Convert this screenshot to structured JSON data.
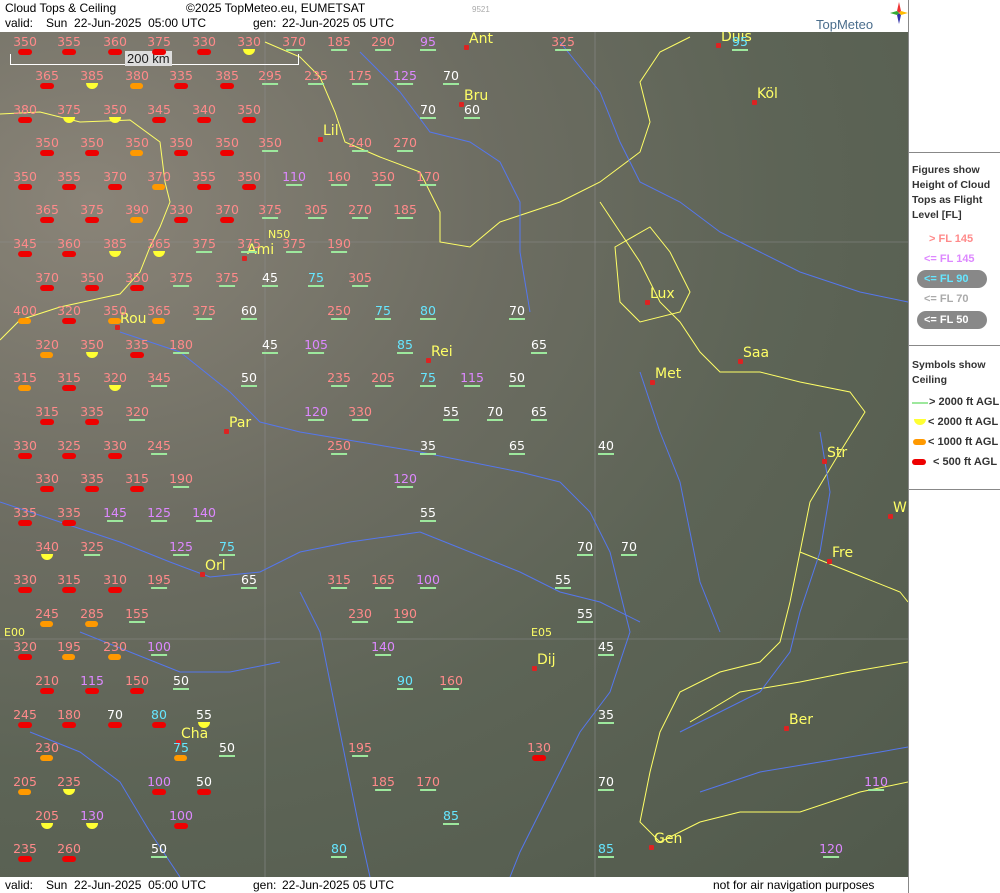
{
  "header": {
    "app_title": "Cloud Tops & Ceiling",
    "copyright": "©2025 TopMeteo.eu, EUMETSAT",
    "valid_label": "valid:",
    "valid_time": "Sun  22-Jun-2025  05:00 UTC",
    "gen_label": "gen:",
    "gen_time": "22-Jun-2025 05 UTC",
    "watermark": "9521",
    "brand": "TopMeteo"
  },
  "footer": {
    "valid_label": "valid:",
    "valid_time": "Sun  22-Jun-2025  05:00 UTC",
    "gen_label": "gen:",
    "gen_time": "22-Jun-2025 05 UTC",
    "disclaimer": "not for air navigation purposes"
  },
  "scale": {
    "label": "200 km"
  },
  "coords": {
    "n50": "N50",
    "e00": "E00",
    "e05": "E05"
  },
  "cities": [
    {
      "name": "Ant"
    },
    {
      "name": "Duis"
    },
    {
      "name": "Bru"
    },
    {
      "name": "Köl"
    },
    {
      "name": "Lil"
    },
    {
      "name": "Ami"
    },
    {
      "name": "Lux"
    },
    {
      "name": "Rou"
    },
    {
      "name": "Rei"
    },
    {
      "name": "Saa"
    },
    {
      "name": "Met"
    },
    {
      "name": "Par"
    },
    {
      "name": "Str"
    },
    {
      "name": "W"
    },
    {
      "name": "Fre"
    },
    {
      "name": "Orl"
    },
    {
      "name": "Dij"
    },
    {
      "name": "Ber"
    },
    {
      "name": "Cha"
    },
    {
      "name": "Gen"
    }
  ],
  "legend": {
    "figures_title": [
      "Figures show",
      "Height of Cloud",
      "Tops as Flight",
      "Level  [FL]"
    ],
    "fl_items": [
      "> FL 145",
      "<= FL 145",
      "<= FL 90",
      "<= FL 70",
      "<= FL 50"
    ],
    "symbols_title": [
      "Symbols show",
      "Ceiling"
    ],
    "sym_items": [
      "> 2000 ft AGL",
      "< 2000 ft AGL",
      "< 1000 ft AGL",
      "< 500 ft AGL"
    ],
    "colors": {
      "hi": "#ff8a8a",
      "mid": "#dd88ff",
      "low": "#66e6ff",
      "vl": "#ffffff",
      "line": "#9de89d",
      "yel": "#ffff33",
      "org": "#ff9900",
      "red": "#ee0000"
    }
  },
  "observations": [
    [
      "350",
      "hi",
      "red"
    ],
    [
      "355",
      "hi",
      "red"
    ],
    [
      "360",
      "hi",
      "red"
    ],
    [
      "375",
      "hi",
      "red"
    ],
    [
      "330",
      "hi",
      "red"
    ],
    [
      "330",
      "hi",
      "yel"
    ],
    [
      "370",
      "hi",
      "line"
    ],
    [
      "185",
      "hi",
      "line"
    ],
    [
      "290",
      "hi",
      "line"
    ],
    [
      "95",
      "mid",
      "line"
    ],
    [
      "325",
      "hi",
      "line"
    ],
    [
      "95",
      "low",
      "line"
    ],
    [
      "365",
      "hi",
      "red"
    ],
    [
      "385",
      "hi",
      "yel"
    ],
    [
      "380",
      "hi",
      "org"
    ],
    [
      "335",
      "hi",
      "red"
    ],
    [
      "385",
      "hi",
      "red"
    ],
    [
      "295",
      "hi",
      "line"
    ],
    [
      "235",
      "hi",
      "line"
    ],
    [
      "175",
      "hi",
      "line"
    ],
    [
      "125",
      "mid",
      "line"
    ],
    [
      "70",
      "vl",
      "line"
    ],
    [
      "380",
      "hi",
      "red"
    ],
    [
      "375",
      "hi",
      "yel"
    ],
    [
      "350",
      "hi",
      "yel"
    ],
    [
      "345",
      "hi",
      "red"
    ],
    [
      "340",
      "hi",
      "red"
    ],
    [
      "350",
      "hi",
      "red"
    ],
    [
      "70",
      "vl",
      "line"
    ],
    [
      "60",
      "vl",
      "line"
    ],
    [
      "350",
      "hi",
      "red"
    ],
    [
      "350",
      "hi",
      "red"
    ],
    [
      "350",
      "hi",
      "org"
    ],
    [
      "350",
      "hi",
      "red"
    ],
    [
      "350",
      "hi",
      "red"
    ],
    [
      "350",
      "hi",
      "line"
    ],
    [
      "240",
      "hi",
      "line"
    ],
    [
      "270",
      "hi",
      "line"
    ],
    [
      "350",
      "hi",
      "red"
    ],
    [
      "355",
      "hi",
      "red"
    ],
    [
      "370",
      "hi",
      "red"
    ],
    [
      "370",
      "hi",
      "org"
    ],
    [
      "355",
      "hi",
      "red"
    ],
    [
      "350",
      "hi",
      "red"
    ],
    [
      "110",
      "mid",
      "line"
    ],
    [
      "160",
      "hi",
      "line"
    ],
    [
      "350",
      "hi",
      "line"
    ],
    [
      "170",
      "hi",
      "line"
    ],
    [
      "365",
      "hi",
      "red"
    ],
    [
      "375",
      "hi",
      "red"
    ],
    [
      "390",
      "hi",
      "org"
    ],
    [
      "330",
      "hi",
      "red"
    ],
    [
      "370",
      "hi",
      "red"
    ],
    [
      "375",
      "hi",
      "line"
    ],
    [
      "305",
      "hi",
      "line"
    ],
    [
      "270",
      "hi",
      "line"
    ],
    [
      "185",
      "hi",
      "line"
    ],
    [
      "345",
      "hi",
      "red"
    ],
    [
      "360",
      "hi",
      "red"
    ],
    [
      "385",
      "hi",
      "yel"
    ],
    [
      "365",
      "hi",
      "yel"
    ],
    [
      "375",
      "hi",
      "line"
    ],
    [
      "375",
      "hi",
      "line"
    ],
    [
      "375",
      "hi",
      "line"
    ],
    [
      "190",
      "hi",
      "line"
    ],
    [
      "370",
      "hi",
      "red"
    ],
    [
      "350",
      "hi",
      "red"
    ],
    [
      "350",
      "hi",
      "red"
    ],
    [
      "375",
      "hi",
      "line"
    ],
    [
      "375",
      "hi",
      "line"
    ],
    [
      "45",
      "vl",
      "line"
    ],
    [
      "75",
      "low",
      "line"
    ],
    [
      "305",
      "hi",
      "line"
    ],
    [
      "400",
      "hi",
      "org"
    ],
    [
      "320",
      "hi",
      "red"
    ],
    [
      "350",
      "hi",
      "org"
    ],
    [
      "365",
      "hi",
      "org"
    ],
    [
      "375",
      "hi",
      "line"
    ],
    [
      "60",
      "vl",
      "line"
    ],
    [
      "250",
      "hi",
      "line"
    ],
    [
      "75",
      "low",
      "line"
    ],
    [
      "80",
      "low",
      "line"
    ],
    [
      "70",
      "vl",
      "line"
    ],
    [
      "320",
      "hi",
      "org"
    ],
    [
      "350",
      "hi",
      "yel"
    ],
    [
      "335",
      "hi",
      "red"
    ],
    [
      "180",
      "hi",
      "line"
    ],
    [
      "45",
      "vl",
      "line"
    ],
    [
      "105",
      "mid",
      "line"
    ],
    [
      "85",
      "low",
      "line"
    ],
    [
      "65",
      "vl",
      "line"
    ],
    [
      "315",
      "hi",
      "org"
    ],
    [
      "315",
      "hi",
      "red"
    ],
    [
      "320",
      "hi",
      "yel"
    ],
    [
      "345",
      "hi",
      "line"
    ],
    [
      "50",
      "vl",
      "line"
    ],
    [
      "235",
      "hi",
      "line"
    ],
    [
      "205",
      "hi",
      "line"
    ],
    [
      "75",
      "low",
      "line"
    ],
    [
      "115",
      "mid",
      "line"
    ],
    [
      "50",
      "vl",
      "line"
    ],
    [
      "315",
      "hi",
      "red"
    ],
    [
      "335",
      "hi",
      "red"
    ],
    [
      "320",
      "hi",
      "line"
    ],
    [
      "120",
      "mid",
      "line"
    ],
    [
      "330",
      "hi",
      "line"
    ],
    [
      "55",
      "vl",
      "line"
    ],
    [
      "70",
      "vl",
      "line"
    ],
    [
      "65",
      "vl",
      "line"
    ],
    [
      "330",
      "hi",
      "red"
    ],
    [
      "325",
      "hi",
      "red"
    ],
    [
      "330",
      "hi",
      "red"
    ],
    [
      "245",
      "hi",
      "line"
    ],
    [
      "250",
      "hi",
      "line"
    ],
    [
      "35",
      "vl",
      "line"
    ],
    [
      "65",
      "vl",
      "line"
    ],
    [
      "40",
      "vl",
      "line"
    ],
    [
      "330",
      "hi",
      "red"
    ],
    [
      "335",
      "hi",
      "red"
    ],
    [
      "315",
      "hi",
      "red"
    ],
    [
      "190",
      "hi",
      "line"
    ],
    [
      "120",
      "mid",
      "line"
    ],
    [
      "335",
      "hi",
      "red"
    ],
    [
      "335",
      "hi",
      "red"
    ],
    [
      "145",
      "mid",
      "line"
    ],
    [
      "125",
      "mid",
      "line"
    ],
    [
      "140",
      "mid",
      "line"
    ],
    [
      "55",
      "vl",
      "line"
    ],
    [
      "340",
      "hi",
      "yel"
    ],
    [
      "325",
      "hi",
      "line"
    ],
    [
      "125",
      "mid",
      "line"
    ],
    [
      "75",
      "low",
      "line"
    ],
    [
      "70",
      "vl",
      "line"
    ],
    [
      "70",
      "vl",
      "line"
    ],
    [
      "330",
      "hi",
      "red"
    ],
    [
      "315",
      "hi",
      "red"
    ],
    [
      "310",
      "hi",
      "red"
    ],
    [
      "195",
      "hi",
      "line"
    ],
    [
      "65",
      "vl",
      "line"
    ],
    [
      "315",
      "hi",
      "line"
    ],
    [
      "165",
      "hi",
      "line"
    ],
    [
      "100",
      "mid",
      "line"
    ],
    [
      "55",
      "vl",
      "line"
    ],
    [
      "245",
      "hi",
      "org"
    ],
    [
      "285",
      "hi",
      "org"
    ],
    [
      "155",
      "hi",
      "line"
    ],
    [
      "230",
      "hi",
      "line"
    ],
    [
      "190",
      "hi",
      "line"
    ],
    [
      "55",
      "vl",
      "line"
    ],
    [
      "320",
      "hi",
      "red"
    ],
    [
      "195",
      "hi",
      "org"
    ],
    [
      "230",
      "hi",
      "org"
    ],
    [
      "100",
      "mid",
      "line"
    ],
    [
      "140",
      "mid",
      "line"
    ],
    [
      "45",
      "vl",
      "line"
    ],
    [
      "210",
      "hi",
      "red"
    ],
    [
      "115",
      "mid",
      "red"
    ],
    [
      "150",
      "hi",
      "red"
    ],
    [
      "50",
      "vl",
      "line"
    ],
    [
      "90",
      "low",
      "line"
    ],
    [
      "160",
      "hi",
      "line"
    ],
    [
      "245",
      "hi",
      "red"
    ],
    [
      "180",
      "hi",
      "red"
    ],
    [
      "70",
      "vl",
      "red"
    ],
    [
      "80",
      "low",
      "red"
    ],
    [
      "55",
      "vl",
      "yel"
    ],
    [
      "35",
      "vl",
      "line"
    ],
    [
      "230",
      "hi",
      "org"
    ],
    [
      "75",
      "low",
      "org"
    ],
    [
      "50",
      "vl",
      "line"
    ],
    [
      "195",
      "hi",
      "line"
    ],
    [
      "130",
      "hi",
      "red"
    ],
    [
      "205",
      "hi",
      "org"
    ],
    [
      "235",
      "hi",
      "yel"
    ],
    [
      "100",
      "mid",
      "red"
    ],
    [
      "50",
      "vl",
      "red"
    ],
    [
      "185",
      "hi",
      "line"
    ],
    [
      "170",
      "hi",
      "line"
    ],
    [
      "70",
      "vl",
      "line"
    ],
    [
      "110",
      "mid",
      "line"
    ],
    [
      "205",
      "hi",
      "yel"
    ],
    [
      "130",
      "mid",
      "yel"
    ],
    [
      "100",
      "mid",
      "red"
    ],
    [
      "85",
      "low",
      "line"
    ],
    [
      "235",
      "hi",
      "red"
    ],
    [
      "260",
      "hi",
      "red"
    ],
    [
      "50",
      "vl",
      "line"
    ],
    [
      "80",
      "low",
      "line"
    ],
    [
      "85",
      "low",
      "line"
    ],
    [
      "120",
      "mid",
      "line"
    ]
  ]
}
